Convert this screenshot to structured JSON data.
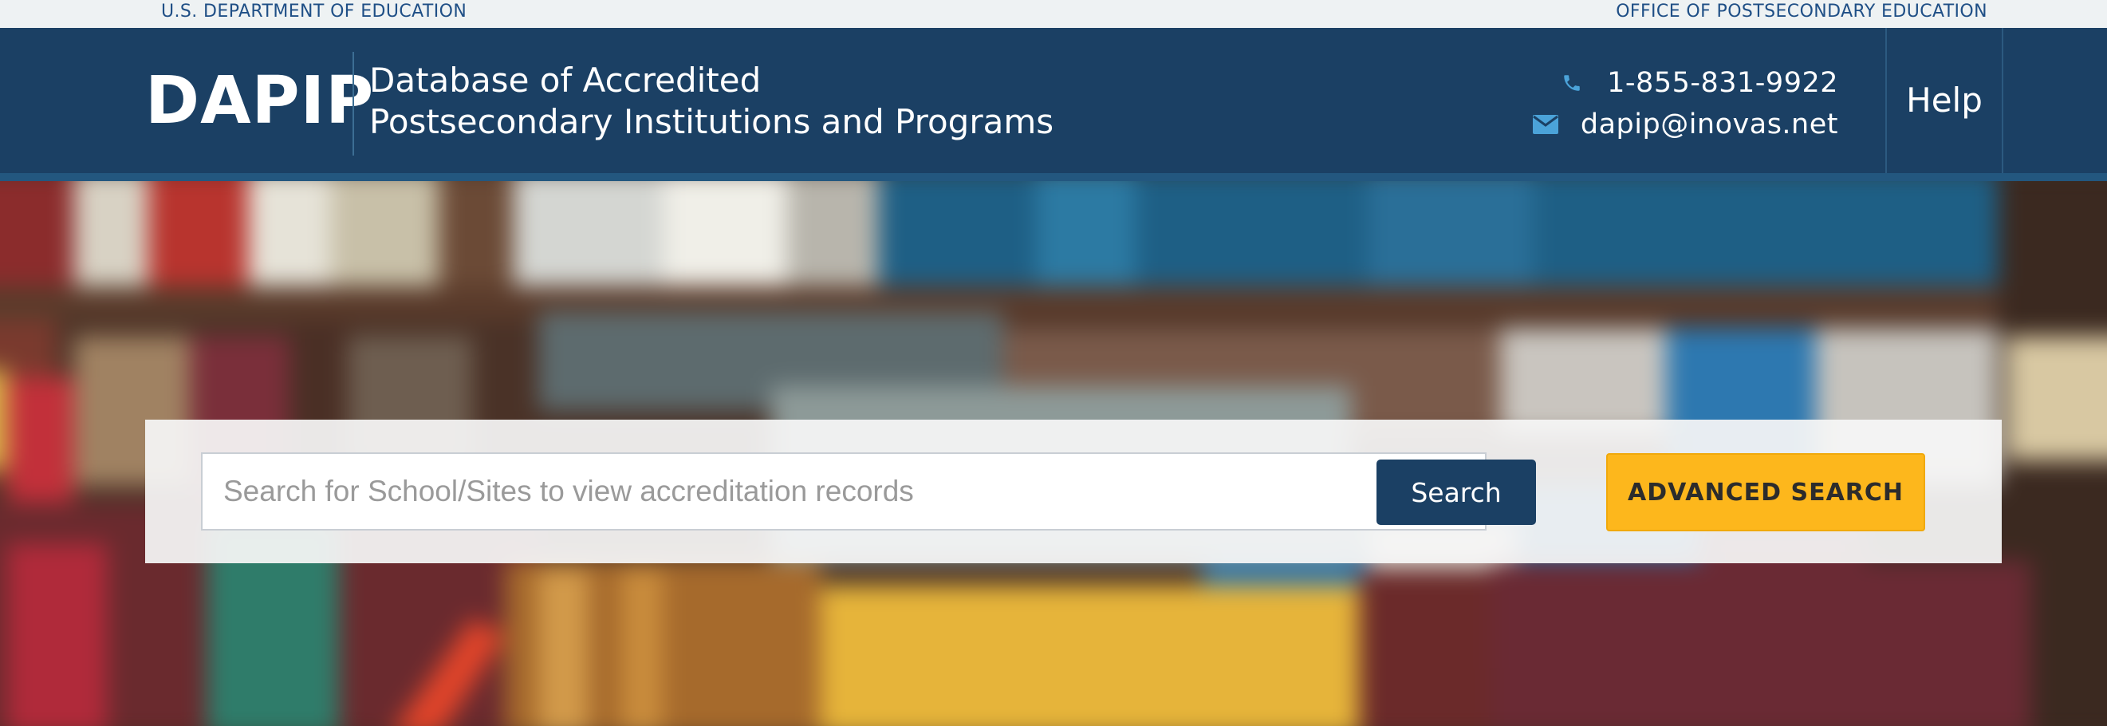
{
  "topbar": {
    "left_label": "U.S. DEPARTMENT OF EDUCATION",
    "right_label": "OFFICE OF POSTSECONDARY EDUCATION"
  },
  "header": {
    "logo": "DAPIP",
    "tagline_line1": "Database of Accredited",
    "tagline_line2": "Postsecondary Institutions and Programs",
    "phone": "1-855-831-9922",
    "email": "dapip@inovas.net",
    "help_label": "Help",
    "phone_icon": "phone-icon",
    "email_icon": "envelope-icon"
  },
  "search": {
    "placeholder": "Search for School/Sites to view accreditation records",
    "button_label": "Search",
    "advanced_label": "ADVANCED SEARCH"
  },
  "colors": {
    "header_bg": "#1b4064",
    "topbar_bg": "#eef2f3",
    "topbar_text": "#1f4f86",
    "accent_yellow": "#fdb71c",
    "icon_blue": "#4ba3d9"
  }
}
